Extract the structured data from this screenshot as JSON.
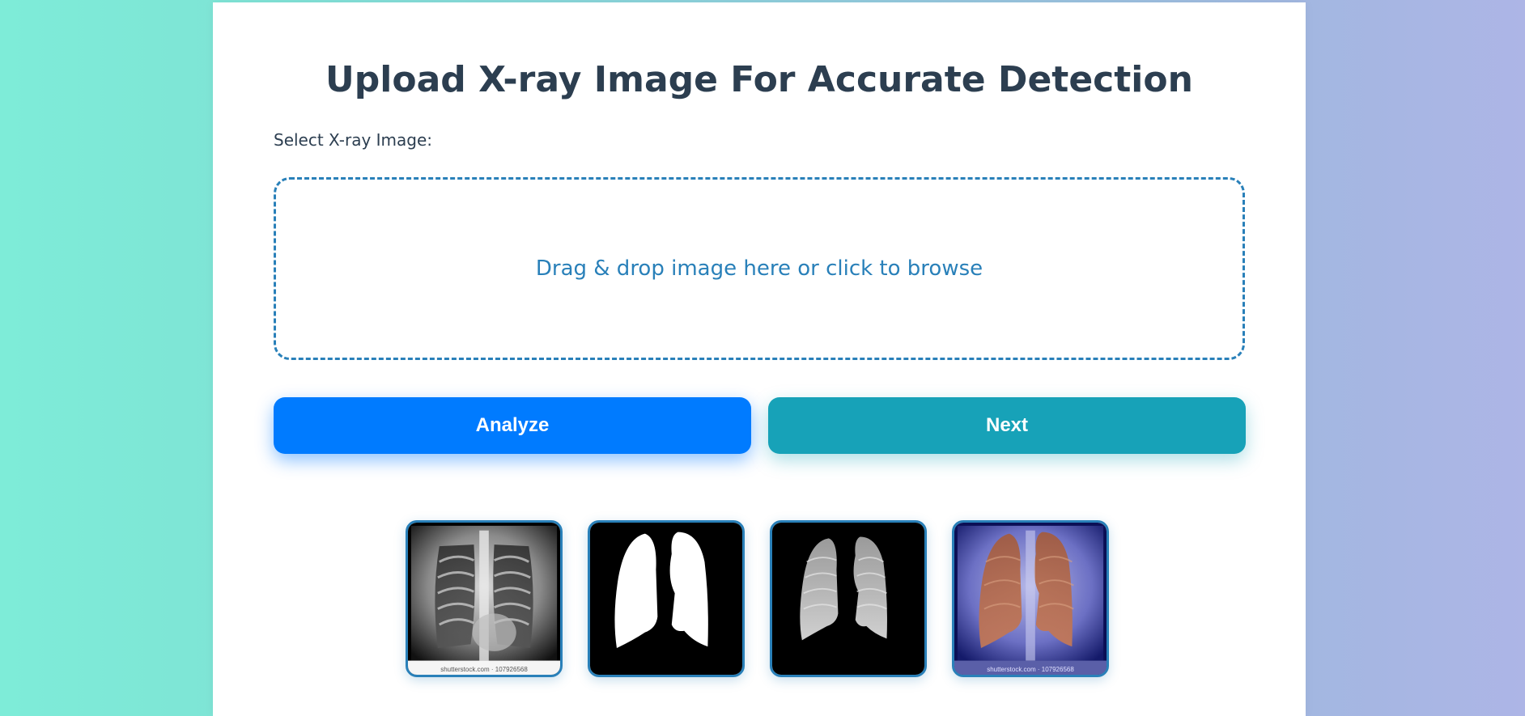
{
  "page": {
    "title": "Upload X-ray Image For Accurate Detection",
    "select_label": "Select X-ray Image:"
  },
  "dropzone": {
    "text": "Drag & drop image here or click to browse"
  },
  "actions": {
    "analyze_label": "Analyze",
    "next_label": "Next"
  },
  "gallery": {
    "images": [
      {
        "name": "original-xray",
        "watermark": "shutterstock.com · 107926568"
      },
      {
        "name": "lung-mask"
      },
      {
        "name": "segmented-lungs"
      },
      {
        "name": "overlay-xray",
        "watermark": "shutterstock.com · 107926568"
      }
    ]
  },
  "colors": {
    "title": "#2c3e50",
    "accent": "#2980b9",
    "analyze": "#007bff",
    "next": "#17a2b8"
  }
}
